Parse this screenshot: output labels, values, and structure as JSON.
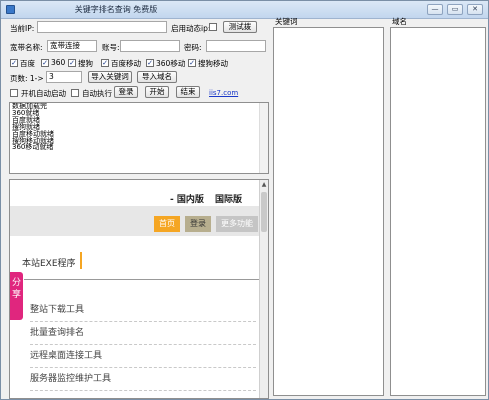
{
  "window": {
    "title": "关键字排名查询 免费版",
    "buttons": {
      "minimize": "—",
      "restore": "▭",
      "close": "✕"
    }
  },
  "form": {
    "current_ip_label": "当前IP:",
    "current_ip_value": "",
    "dynamic_ip_label": "启用动态ip:",
    "test_button": "测试拨",
    "broadband_label": "宽带名称:",
    "broadband_value": "宽带连接",
    "account_label": "账号:",
    "account_value": "",
    "password_label": "密码:",
    "password_value": "",
    "engines": [
      {
        "label": "百度",
        "checked": true
      },
      {
        "label": "360",
        "checked": true
      },
      {
        "label": "搜狗",
        "checked": true
      },
      {
        "label": "百度移动",
        "checked": true
      },
      {
        "label": "360移动",
        "checked": true
      },
      {
        "label": "搜狗移动",
        "checked": true
      }
    ],
    "pages_label": "页数: 1->",
    "pages_value": "3",
    "import_keywords_button": "导入关键词",
    "import_domains_button": "导入域名",
    "autostart_label": "开机自动启动",
    "autorun_label": "自动执行",
    "login_button": "登录",
    "start_button": "开始",
    "stop_button": "结束",
    "site_link": "iis7.com"
  },
  "log": {
    "lines": [
      "数据加载完",
      "360就绪",
      "百度就绪",
      "搜狗就绪",
      "百度移动就绪",
      "搜狗移动就绪",
      "360移动就绪"
    ]
  },
  "browser": {
    "nav": {
      "domestic": "- 国内版",
      "international": "国际版"
    },
    "tabs": {
      "home": "首页",
      "login": "登录",
      "more": "更多功能"
    },
    "site_program": "本站EXE程序",
    "share": "分享",
    "menu": [
      "整站下载工具",
      "批量查询排名",
      "远程桌面连接工具",
      "服务器监控维护工具"
    ],
    "colors": {
      "home_tab": "#f5a623",
      "login_tab": "#b7ae8e",
      "more_tab": "#c5c5c5",
      "share": "#e0267e"
    }
  },
  "panels": {
    "keywords_header": "关键词",
    "domains_header": "域名"
  }
}
